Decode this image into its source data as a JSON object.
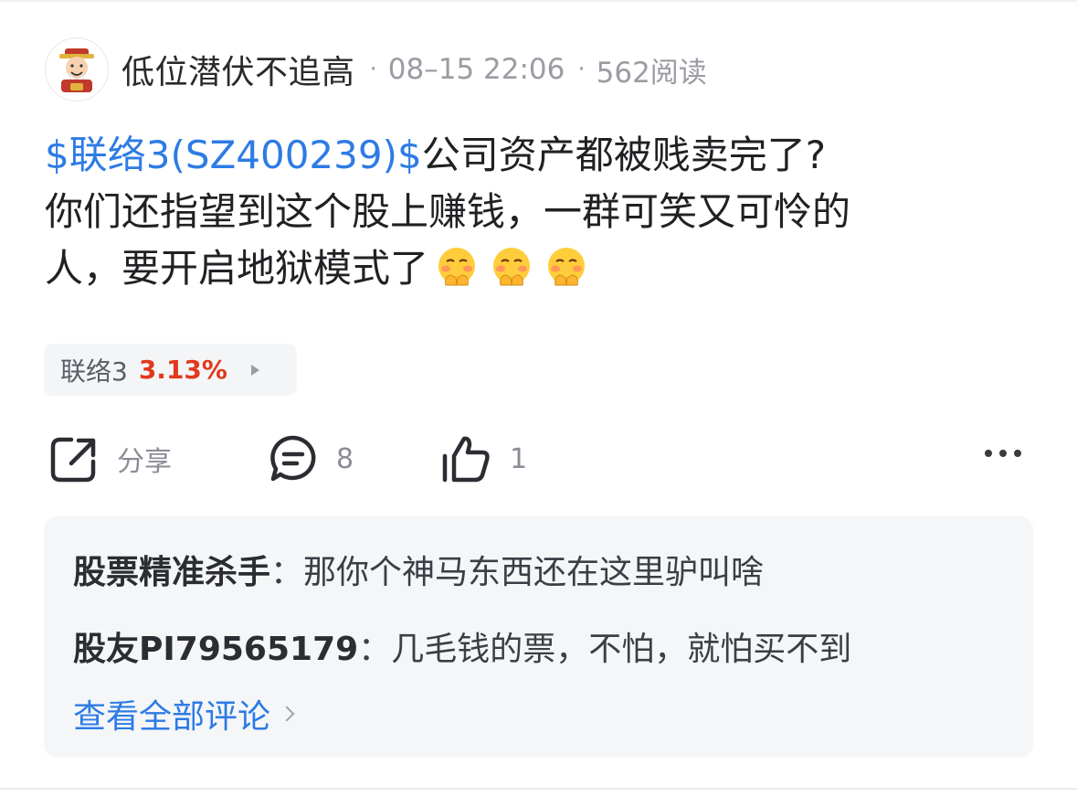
{
  "post": {
    "author": "低位潜伏不追高",
    "time": "08–15 22:06",
    "reads": "562阅读",
    "stock_tag": "$联络3(SZ400239)$",
    "text_line1": "公司资产都被贱卖完了?",
    "text_line2": "你们还指望到这个股上赚钱，一群可笑又可怜的",
    "text_line3": "人，要开启地狱模式了",
    "emoji_icon": "shushing-face-emoji",
    "emoji_count": 3
  },
  "chip": {
    "name": "联络3",
    "change": "3.13%",
    "change_color": "#e0391d"
  },
  "actions": {
    "share_label": "分享",
    "comment_count": "8",
    "like_count": "1"
  },
  "comments": {
    "items": [
      {
        "user": "股票精准杀手",
        "sep": "：",
        "text": "那你个神马东西还在这里驴叫啥"
      },
      {
        "user": "股友PI79565179",
        "sep": "：",
        "text": "几毛钱的票，不怕，就怕买不到"
      }
    ],
    "view_all": "查看全部评论"
  },
  "colors": {
    "link": "#2d7be5",
    "meta": "#9a9ca3",
    "panel": "#f5f6f8"
  }
}
